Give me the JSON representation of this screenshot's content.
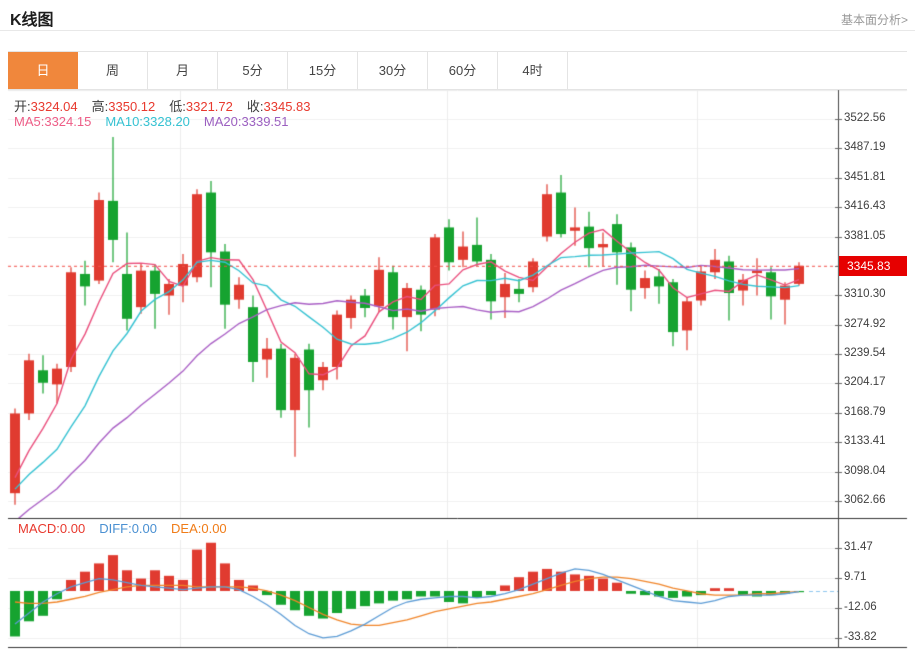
{
  "header": {
    "title": "K线图",
    "analysis_link": "基本面分析>"
  },
  "tabs": {
    "active_index": 0,
    "active_color": "#f0873c",
    "items": [
      {
        "label": "日"
      },
      {
        "label": "周"
      },
      {
        "label": "月"
      },
      {
        "label": "5分"
      },
      {
        "label": "15分"
      },
      {
        "label": "30分"
      },
      {
        "label": "60分"
      },
      {
        "label": "4时"
      }
    ]
  },
  "ohlc_row": {
    "items": [
      {
        "label": "开:",
        "value": "3324.04"
      },
      {
        "label": "高:",
        "value": "3350.12"
      },
      {
        "label": "低:",
        "value": "3321.72"
      },
      {
        "label": "收:",
        "value": "3345.83"
      }
    ],
    "value_color": "#e8392e"
  },
  "ma_row": {
    "items": [
      {
        "label": "MA5:",
        "value": "3324.15",
        "color": "#ee5d87"
      },
      {
        "label": "MA10:",
        "value": "3328.20",
        "color": "#35c2d2"
      },
      {
        "label": "MA20:",
        "value": "3339.51",
        "color": "#9b5fc0"
      }
    ]
  },
  "macd_row": {
    "items": [
      {
        "label": "MACD:",
        "value": "0.00",
        "color": "#e8392e"
      },
      {
        "label": "DIFF:",
        "value": "0.00",
        "color": "#4a90d2"
      },
      {
        "label": "DEA:",
        "value": "0.00",
        "color": "#f07c18"
      }
    ]
  },
  "price_badge": {
    "value": "3345.83",
    "color": "#e60000"
  },
  "chart_data": {
    "type": "candlestick",
    "up_color": "#e03b30",
    "down_color": "#16a330",
    "grid_color": "#f1f1f1",
    "price_axis": {
      "tick_labels": [
        "3522.56",
        "3487.19",
        "3451.81",
        "3416.43",
        "3381.05",
        "3310.30",
        "3274.92",
        "3239.54",
        "3204.17",
        "3168.79",
        "3133.41",
        "3098.04",
        "3062.66"
      ],
      "badge_slot": 5,
      "top_value": 3522.56,
      "step_value": 35.375,
      "last_price": 3345.83
    },
    "candles": [
      [
        3072,
        3174,
        3058,
        3168
      ],
      [
        3168,
        3240,
        3160,
        3232
      ],
      [
        3220,
        3238,
        3192,
        3205
      ],
      [
        3203,
        3228,
        3180,
        3222
      ],
      [
        3224,
        3344,
        3218,
        3338
      ],
      [
        3336,
        3352,
        3298,
        3321
      ],
      [
        3328,
        3434,
        3324,
        3425
      ],
      [
        3424,
        3501,
        3350,
        3377
      ],
      [
        3336,
        3386,
        3268,
        3282
      ],
      [
        3296,
        3348,
        3288,
        3340
      ],
      [
        3340,
        3347,
        3270,
        3312
      ],
      [
        3310,
        3330,
        3287,
        3324
      ],
      [
        3322,
        3360,
        3302,
        3348
      ],
      [
        3332,
        3438,
        3326,
        3432
      ],
      [
        3434,
        3448,
        3320,
        3362
      ],
      [
        3363,
        3372,
        3270,
        3299
      ],
      [
        3305,
        3332,
        3294,
        3323
      ],
      [
        3296,
        3310,
        3206,
        3230
      ],
      [
        3233,
        3259,
        3211,
        3246
      ],
      [
        3246,
        3252,
        3163,
        3172
      ],
      [
        3172,
        3240,
        3116,
        3235
      ],
      [
        3245,
        3252,
        3151,
        3196
      ],
      [
        3208,
        3230,
        3196,
        3224
      ],
      [
        3224,
        3292,
        3209,
        3287
      ],
      [
        3283,
        3310,
        3270,
        3305
      ],
      [
        3310,
        3318,
        3284,
        3295
      ],
      [
        3297,
        3356,
        3290,
        3341
      ],
      [
        3338,
        3346,
        3269,
        3284
      ],
      [
        3284,
        3325,
        3243,
        3319
      ],
      [
        3317,
        3322,
        3267,
        3287
      ],
      [
        3293,
        3384,
        3285,
        3380
      ],
      [
        3392,
        3402,
        3340,
        3350
      ],
      [
        3353,
        3387,
        3344,
        3369
      ],
      [
        3371,
        3404,
        3346,
        3351
      ],
      [
        3353,
        3360,
        3281,
        3303
      ],
      [
        3308,
        3337,
        3283,
        3324
      ],
      [
        3318,
        3330,
        3302,
        3312
      ],
      [
        3320,
        3355,
        3314,
        3351
      ],
      [
        3381,
        3444,
        3375,
        3432
      ],
      [
        3434,
        3455,
        3380,
        3384
      ],
      [
        3388,
        3416,
        3370,
        3392
      ],
      [
        3393,
        3411,
        3344,
        3367
      ],
      [
        3368,
        3386,
        3345,
        3372
      ],
      [
        3396,
        3408,
        3323,
        3362
      ],
      [
        3368,
        3374,
        3291,
        3317
      ],
      [
        3319,
        3340,
        3306,
        3331
      ],
      [
        3333,
        3342,
        3300,
        3321
      ],
      [
        3326,
        3330,
        3249,
        3266
      ],
      [
        3268,
        3308,
        3244,
        3303
      ],
      [
        3304,
        3346,
        3298,
        3339
      ],
      [
        3338,
        3366,
        3330,
        3353
      ],
      [
        3351,
        3358,
        3280,
        3313
      ],
      [
        3316,
        3336,
        3298,
        3329
      ],
      [
        3337,
        3355,
        3310,
        3340
      ],
      [
        3338,
        3344,
        3281,
        3309
      ],
      [
        3305,
        3326,
        3275,
        3322
      ],
      [
        3324.04,
        3350.12,
        3321.72,
        3345.83
      ]
    ],
    "ma_periods": [
      5,
      10,
      20
    ],
    "ma_colors": [
      "#ea4f7d",
      "#35c2d2",
      "#a95fc5"
    ],
    "ma_prehistory": [
      2930,
      2945,
      2958,
      2970,
      2982,
      2994,
      3006,
      3018,
      3030,
      3040,
      3048,
      3055,
      3060,
      3064,
      3067,
      3069,
      3070,
      3071,
      3072,
      3073
    ],
    "vertical_gridlines_x": [
      180.5,
      447.5,
      697.5
    ],
    "macd_panel": {
      "tick_labels": [
        "31.47",
        "9.71",
        "-12.06",
        "-33.82"
      ],
      "top_value": 31.47,
      "step_value": 21.765,
      "up_color": "#e03b30",
      "down_color": "#16a330",
      "diff_color": "#5b9bd5",
      "dea_color": "#f08428",
      "zero_dash_color": "#8ec6ef",
      "hist": [
        -33,
        -22,
        -18,
        -6,
        8,
        14,
        20,
        26,
        15,
        9,
        15,
        11,
        8,
        30,
        35,
        20,
        8,
        4,
        -3,
        -10,
        -14,
        -18,
        -20,
        -16,
        -13,
        -11,
        -9,
        -7,
        -6,
        -4,
        -4,
        -8,
        -9,
        -5,
        -3,
        4,
        10,
        14,
        16,
        14,
        12,
        11,
        9,
        6,
        -2,
        -3,
        -4,
        -5,
        -4,
        -3,
        2,
        2,
        -3,
        -4,
        -3,
        -2,
        -0.5
      ],
      "diff": [
        -24,
        -16,
        -8,
        -2,
        3,
        6,
        9,
        8,
        6,
        4,
        3,
        2,
        1,
        2,
        3,
        3,
        1,
        -4,
        -10,
        -17,
        -25,
        -31,
        -34,
        -33,
        -29,
        -24,
        -18,
        -12,
        -8,
        -6,
        -5,
        -4,
        -4,
        -5,
        -4,
        -2,
        1,
        5,
        9,
        13,
        16,
        15,
        12,
        8,
        4,
        0,
        -4,
        -7,
        -8,
        -9,
        -7,
        -4,
        -3,
        -3,
        -3,
        -2,
        -0.5
      ],
      "dea": [
        -8,
        -9,
        -9,
        -8,
        -6,
        -4,
        -1,
        1,
        3,
        4,
        4,
        4,
        4,
        3,
        3,
        3,
        3,
        2,
        0,
        -3,
        -7,
        -12,
        -17,
        -21,
        -24,
        -25,
        -25,
        -23,
        -21,
        -18,
        -15,
        -13,
        -11,
        -9,
        -8,
        -6,
        -4,
        -2,
        1,
        4,
        7,
        9,
        10,
        10,
        9,
        7,
        5,
        2,
        0,
        -2,
        -3,
        -3,
        -3,
        -2,
        -2,
        -1,
        -0.5
      ]
    }
  }
}
